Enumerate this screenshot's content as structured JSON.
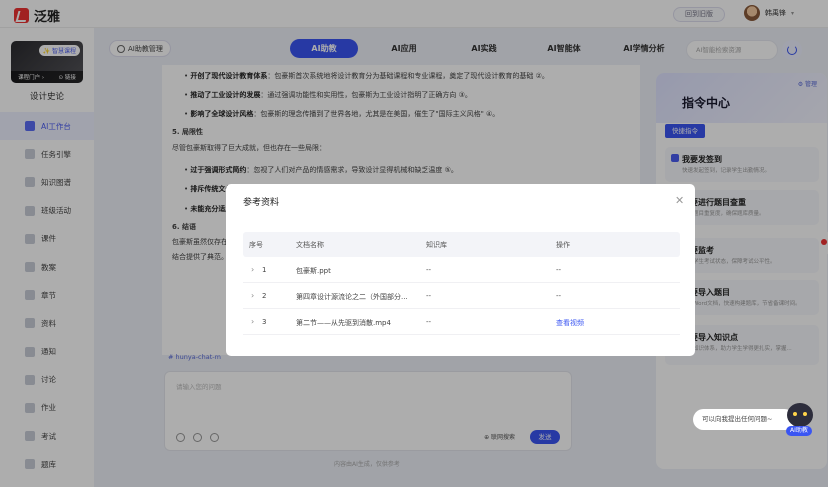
{
  "app": {
    "name": "泛雅"
  },
  "header": {
    "back_old": "回到旧版",
    "user_name": "韩禹锋"
  },
  "course": {
    "badge": "✨ 智慧课程",
    "portal": "课程门户 ›",
    "link": "⊙ 链接",
    "title": "设计史论"
  },
  "sidebar": {
    "items": [
      {
        "label": "AI工作台",
        "active": true
      },
      {
        "label": "任务引擎"
      },
      {
        "label": "知识图谱"
      },
      {
        "label": "班级活动"
      },
      {
        "label": "课件"
      },
      {
        "label": "教案"
      },
      {
        "label": "章节"
      },
      {
        "label": "资料"
      },
      {
        "label": "通知"
      },
      {
        "label": "讨论"
      },
      {
        "label": "作业"
      },
      {
        "label": "考试"
      },
      {
        "label": "题库"
      }
    ]
  },
  "toolbar": {
    "ai_manage": "AI助教管理",
    "search_placeholder": "AI智能检索资源"
  },
  "tabs": [
    {
      "label": "AI助教",
      "active": true
    },
    {
      "label": "AI应用"
    },
    {
      "label": "AI实践"
    },
    {
      "label": "AI智能体"
    },
    {
      "label": "AI学情分析"
    }
  ],
  "content": {
    "l1": {
      "bold": "开创了现代设计教育体系",
      "rest": "：包豪斯首次系统地将设计教育分为基础课程和专业课程，奠定了现代设计教育的基础 ②。"
    },
    "l2": {
      "bold": "推动了工业设计的发展",
      "rest": "：通过强调功能性和实用性，包豪斯为工业设计指明了正确方向 ③。"
    },
    "l3": {
      "bold": "影响了全球设计风格",
      "rest": "：包豪斯的理念传播到了世界各地，尤其是在美国，催生了\"国际主义风格\" ④。"
    },
    "h5": "5. 局限性",
    "p5": "尽管包豪斯取得了巨大成就，但也存在一些局限：",
    "l4": {
      "bold": "过于强调形式简约",
      "rest": "：忽视了人们对产品的情感需求，导致设计显得机械和缺乏温度 ⑤。"
    },
    "l5": {
      "bold": "排斥传统文化"
    },
    "l6": {
      "bold": "未能充分适应"
    },
    "h6": "6. 结语",
    "p6a": "包豪斯虽然仅存在",
    "p6b": "结合提供了典范。"
  },
  "chat": {
    "tag": "# hunya-chat-m",
    "input_placeholder": "请输入您的问题",
    "net_search": "⊕ 联网搜索",
    "send": "发送",
    "footnote": "内容由AI生成，仅供参考"
  },
  "right_panel": {
    "title": "指令中心",
    "manage": "⚙ 管理",
    "quick": "快捷指令",
    "cards": [
      {
        "title": "我要发签到",
        "desc": "快速发起签到，记录学生出勤情况。"
      },
      {
        "title": "我要进行题目查重",
        "desc": "检测题目重复度，确保题库质量。"
      },
      {
        "title": "我要监考",
        "desc": "查看学生考试状态，保障考试公平性。"
      },
      {
        "title": "我要导入题目",
        "desc": "导入Word文档，快速构建题库，节省备课时间。"
      },
      {
        "title": "我要导入知识点",
        "desc": "导入知识体系，助力学生学得更扎实，掌握..."
      }
    ]
  },
  "modal": {
    "title": "参考资料",
    "columns": [
      "序号",
      "文档名称",
      "知识库",
      "操作"
    ],
    "rows": [
      {
        "index": "1",
        "name": "包豪斯.ppt",
        "kb": "--",
        "action": "--"
      },
      {
        "index": "2",
        "name": "第四章设计源流论之二（外国部分...",
        "kb": "--",
        "action": "--"
      },
      {
        "index": "3",
        "name": "第二节——从先驱到消散.mp4",
        "kb": "--",
        "action": "查看视频"
      }
    ]
  },
  "helper": {
    "text": "可以向我提出任何问题~",
    "badge": "AI助教"
  },
  "colors": {
    "accent": "#3a55f2",
    "brand": "#e33333"
  }
}
